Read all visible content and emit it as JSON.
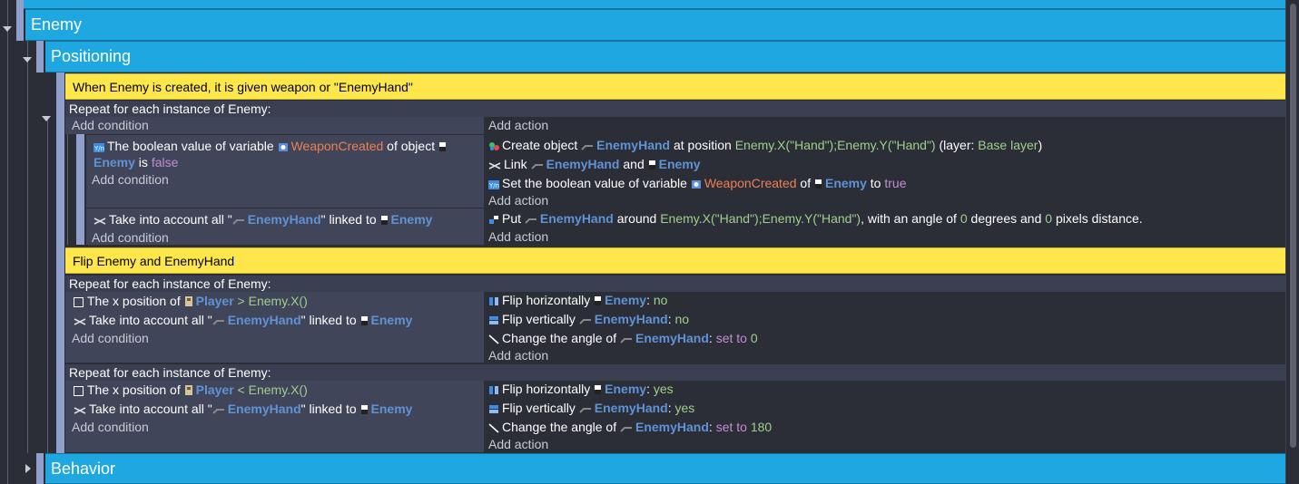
{
  "groups": {
    "enemy": "Enemy",
    "positioning": "Positioning",
    "behavior": "Behavior"
  },
  "comments": {
    "c1": "When Enemy is created, it is given weapon or \"EnemyHand\"",
    "c2": "Flip Enemy and EnemyHand"
  },
  "common": {
    "add_condition": "Add condition",
    "add_action": "Add action",
    "repeat_each_enemy": "Repeat for each instance of Enemy:"
  },
  "event1": {
    "cond1": {
      "t1": "The boolean value of variable ",
      "var": "WeaponCreated",
      "t2": " of object ",
      "obj": "Enemy",
      "t3": " is ",
      "val": "false"
    },
    "cond2": {
      "t1": "Take into account all \"",
      "obj1": "EnemyHand",
      "t2": "\" linked to ",
      "obj2": "Enemy"
    },
    "act1": {
      "t1": "Create object ",
      "obj": "EnemyHand",
      "t2": " at position ",
      "pos": "Enemy.X(\"Hand\");Enemy.Y(\"Hand\")",
      "t3": " (layer: ",
      "layer": "Base layer",
      "t4": ")"
    },
    "act2": {
      "t1": "Link ",
      "obj1": "EnemyHand",
      "t2": " and ",
      "obj2": "Enemy"
    },
    "act3": {
      "t1": "Set the boolean value of variable ",
      "var": "WeaponCreated",
      "t2": " of ",
      "obj": "Enemy",
      "t3": " to ",
      "val": "true"
    },
    "act4": {
      "t1": "Put ",
      "obj": "EnemyHand",
      "t2": " around ",
      "pos": "Enemy.X(\"Hand\");Enemy.Y(\"Hand\")",
      "t3": ", with an angle of ",
      "angle": "0",
      "t4": " degrees and ",
      "dist": "0",
      "t5": " pixels distance."
    }
  },
  "event2": {
    "cond1": {
      "t1": "The x position of ",
      "obj": "Player",
      "op": " > ",
      "expr": "Enemy.X()"
    },
    "cond2": {
      "t1": "Take into account all \"",
      "obj1": "EnemyHand",
      "t2": "\" linked to ",
      "obj2": "Enemy"
    },
    "act1": {
      "t1": "Flip horizontally ",
      "obj": "Enemy",
      "sep": ": ",
      "val": "no"
    },
    "act2": {
      "t1": "Flip vertically ",
      "obj": "EnemyHand",
      "sep": ": ",
      "val": "no"
    },
    "act3": {
      "t1": "Change the angle of ",
      "obj": "EnemyHand",
      "sep": ": ",
      "kw": "set to",
      "val": "0"
    }
  },
  "event3": {
    "cond1": {
      "t1": "The x position of ",
      "obj": "Player",
      "op": " < ",
      "expr": "Enemy.X()"
    },
    "cond2": {
      "t1": "Take into account all \"",
      "obj1": "EnemyHand",
      "t2": "\" linked to ",
      "obj2": "Enemy"
    },
    "act1": {
      "t1": "Flip horizontally ",
      "obj": "Enemy",
      "sep": ": ",
      "val": "yes"
    },
    "act2": {
      "t1": "Flip vertically ",
      "obj": "EnemyHand",
      "sep": ": ",
      "val": "yes"
    },
    "act3": {
      "t1": "Change the angle of ",
      "obj": "EnemyHand",
      "sep": ": ",
      "kw": "set to",
      "val": "180"
    }
  },
  "colors": {
    "group_bg": "#1fa7e1",
    "comment_bg": "#ffe74b",
    "object_name": "#5f93d6",
    "variable_name": "#f07f52",
    "value": "#9ed08c",
    "keyword": "#c28dd6"
  },
  "icons": {
    "bool_var": "variable-icon",
    "object": "object-icon",
    "link": "link-icon",
    "create": "create-object-icon",
    "put": "put-around-icon",
    "flip_h": "flip-horizontal-icon",
    "flip_v": "flip-vertical-icon",
    "angle": "angle-icon",
    "checkbox": "position-compare-icon"
  }
}
